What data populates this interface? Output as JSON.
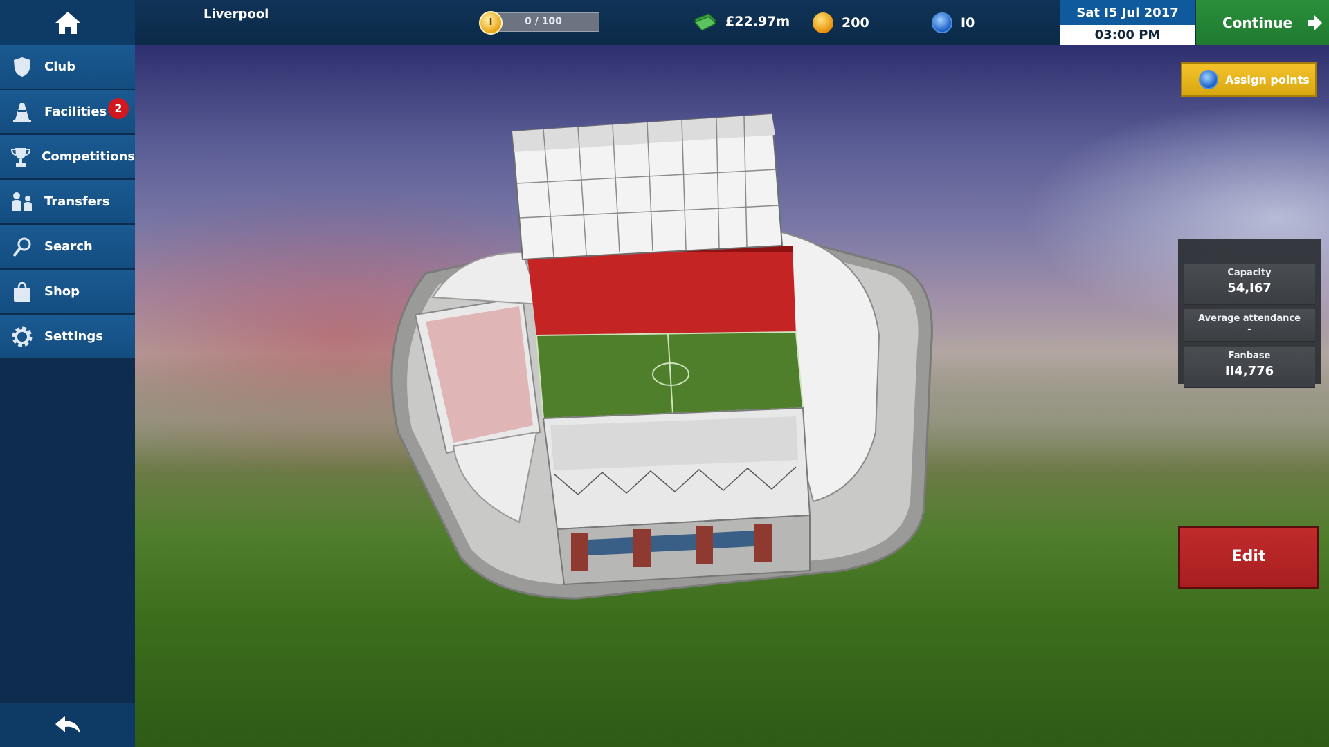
{
  "header": {
    "club_name": "Liverpool",
    "xp": {
      "level": "I",
      "text": "0 / 100",
      "fraction": 0.0
    },
    "money": "£22.97m",
    "coins": "200",
    "gems": "I0",
    "date": "Sat I5 Jul 2017",
    "time": "03:00 PM",
    "continue_label": "Continue"
  },
  "sidebar": {
    "items": [
      {
        "label": "Club",
        "icon": "shield-icon"
      },
      {
        "label": "Facilities",
        "icon": "cone-icon",
        "badge": "2"
      },
      {
        "label": "Competitions",
        "icon": "trophy-icon"
      },
      {
        "label": "Transfers",
        "icon": "transfers-icon"
      },
      {
        "label": "Search",
        "icon": "search-icon"
      },
      {
        "label": "Shop",
        "icon": "shopping-bag-icon"
      },
      {
        "label": "Settings",
        "icon": "gear-icon"
      }
    ]
  },
  "panel": {
    "assign_label": "Assign points",
    "stats": [
      {
        "label": "Capacity",
        "value": "54,I67"
      },
      {
        "label": "Average attendance",
        "value": "-"
      },
      {
        "label": "Fanbase",
        "value": "II4,776"
      }
    ],
    "edit_label": "Edit"
  },
  "colors": {
    "accent_blue": "#1a5a92",
    "continue_green": "#2a8f3c",
    "assign_gold": "#f4c22b",
    "edit_red": "#c12b2b",
    "badge_red": "#d2171f"
  }
}
